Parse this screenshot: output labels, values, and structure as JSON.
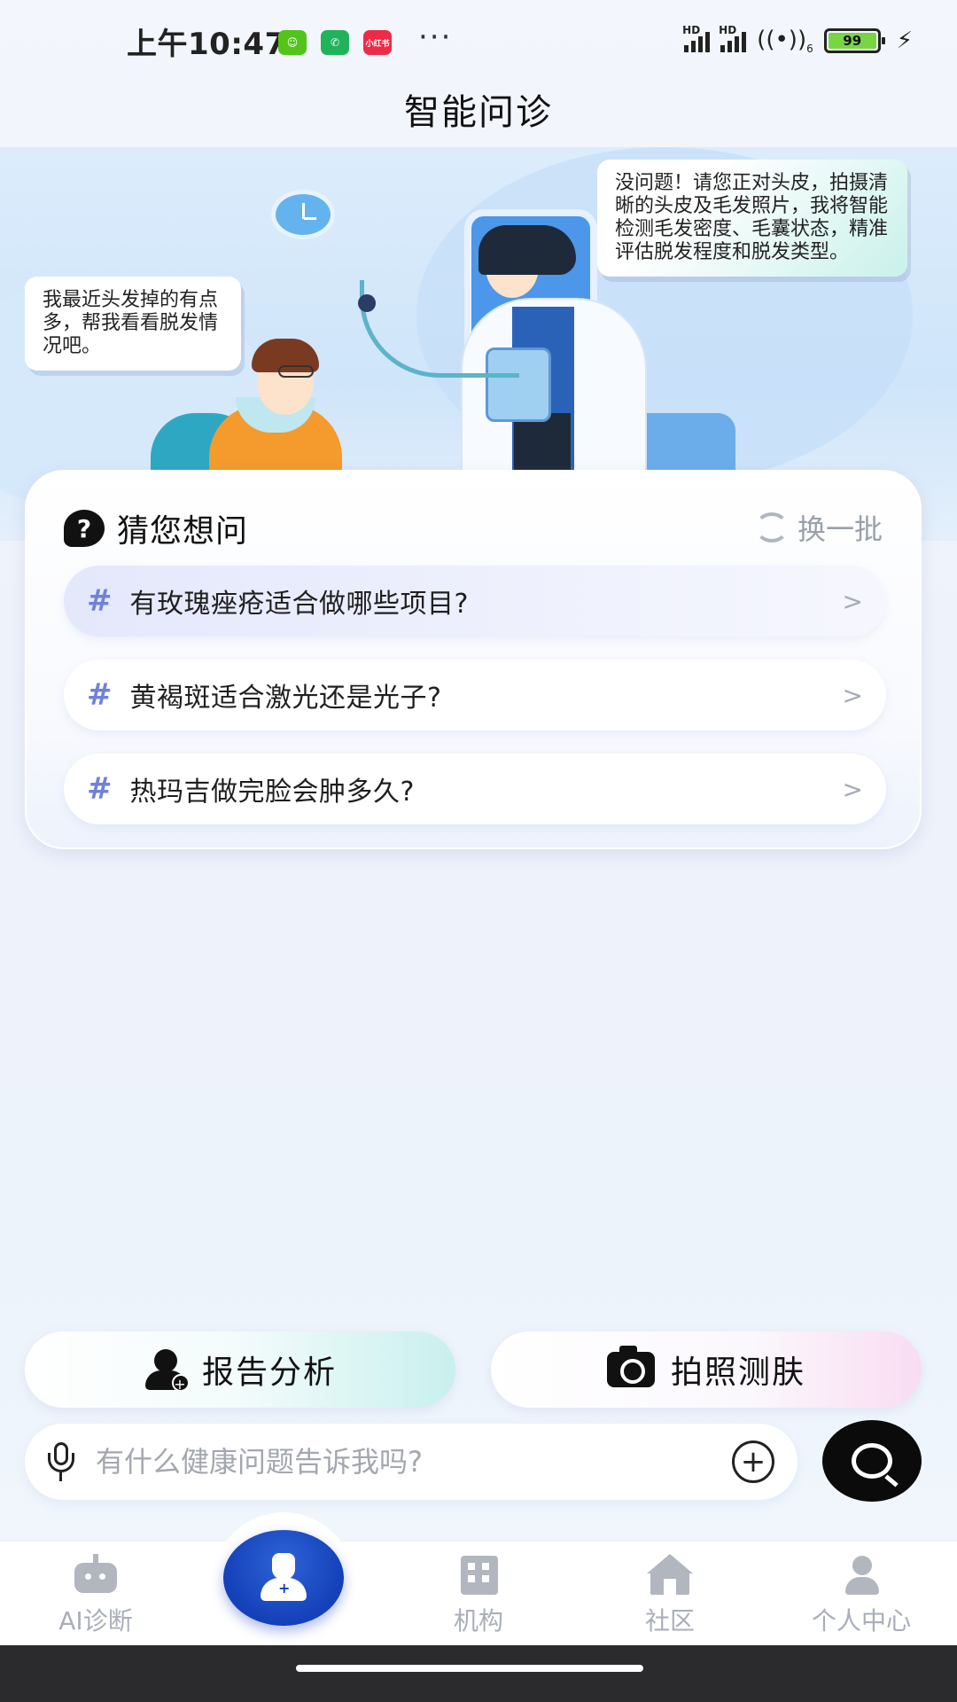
{
  "status_bar": {
    "time": "上午10:47",
    "apps": [
      {
        "name": "wechat-like-app-icon",
        "color": "#52c41a"
      },
      {
        "name": "phone-app-icon",
        "color": "#21b35a"
      },
      {
        "name": "xiaohongshu-app-icon",
        "color": "#ee2b47",
        "label": "小红书"
      }
    ],
    "more": "···",
    "network": "HD",
    "wifi_label": "6",
    "battery": "99"
  },
  "header": {
    "title": "智能问诊"
  },
  "banner": {
    "patient_message": "我最近头发掉的有点多，帮我看看脱发情况吧。",
    "doctor_message": "没问题！请您正对头皮，拍摄清晰的头皮及毛发照片，我将智能检测毛发密度、毛囊状态，精准评估脱发程度和脱发类型。"
  },
  "suggestions": {
    "title": "猜您想问",
    "refresh_label": "换一批",
    "items": [
      {
        "text": "有玫瑰痤疮适合做哪些项目?"
      },
      {
        "text": "黄褐斑适合激光还是光子?"
      },
      {
        "text": "热玛吉做完脸会肿多久?"
      }
    ],
    "hash": "#",
    "arrow": ">"
  },
  "actions": {
    "report_label": "报告分析",
    "photo_label": "拍照测肤"
  },
  "input": {
    "placeholder": "有什么健康问题告诉我吗?",
    "value": ""
  },
  "bottom_nav": {
    "items": [
      {
        "label": "AI诊断",
        "icon": "robot-icon"
      },
      {
        "label": "",
        "icon": "doctor-icon"
      },
      {
        "label": "机构",
        "icon": "building-icon"
      },
      {
        "label": "社区",
        "icon": "home-icon"
      },
      {
        "label": "个人中心",
        "icon": "person-icon"
      }
    ]
  },
  "colors": {
    "accent": "#1440b8",
    "hash": "#6f82d8",
    "nav_inactive": "#a9aeb8"
  }
}
